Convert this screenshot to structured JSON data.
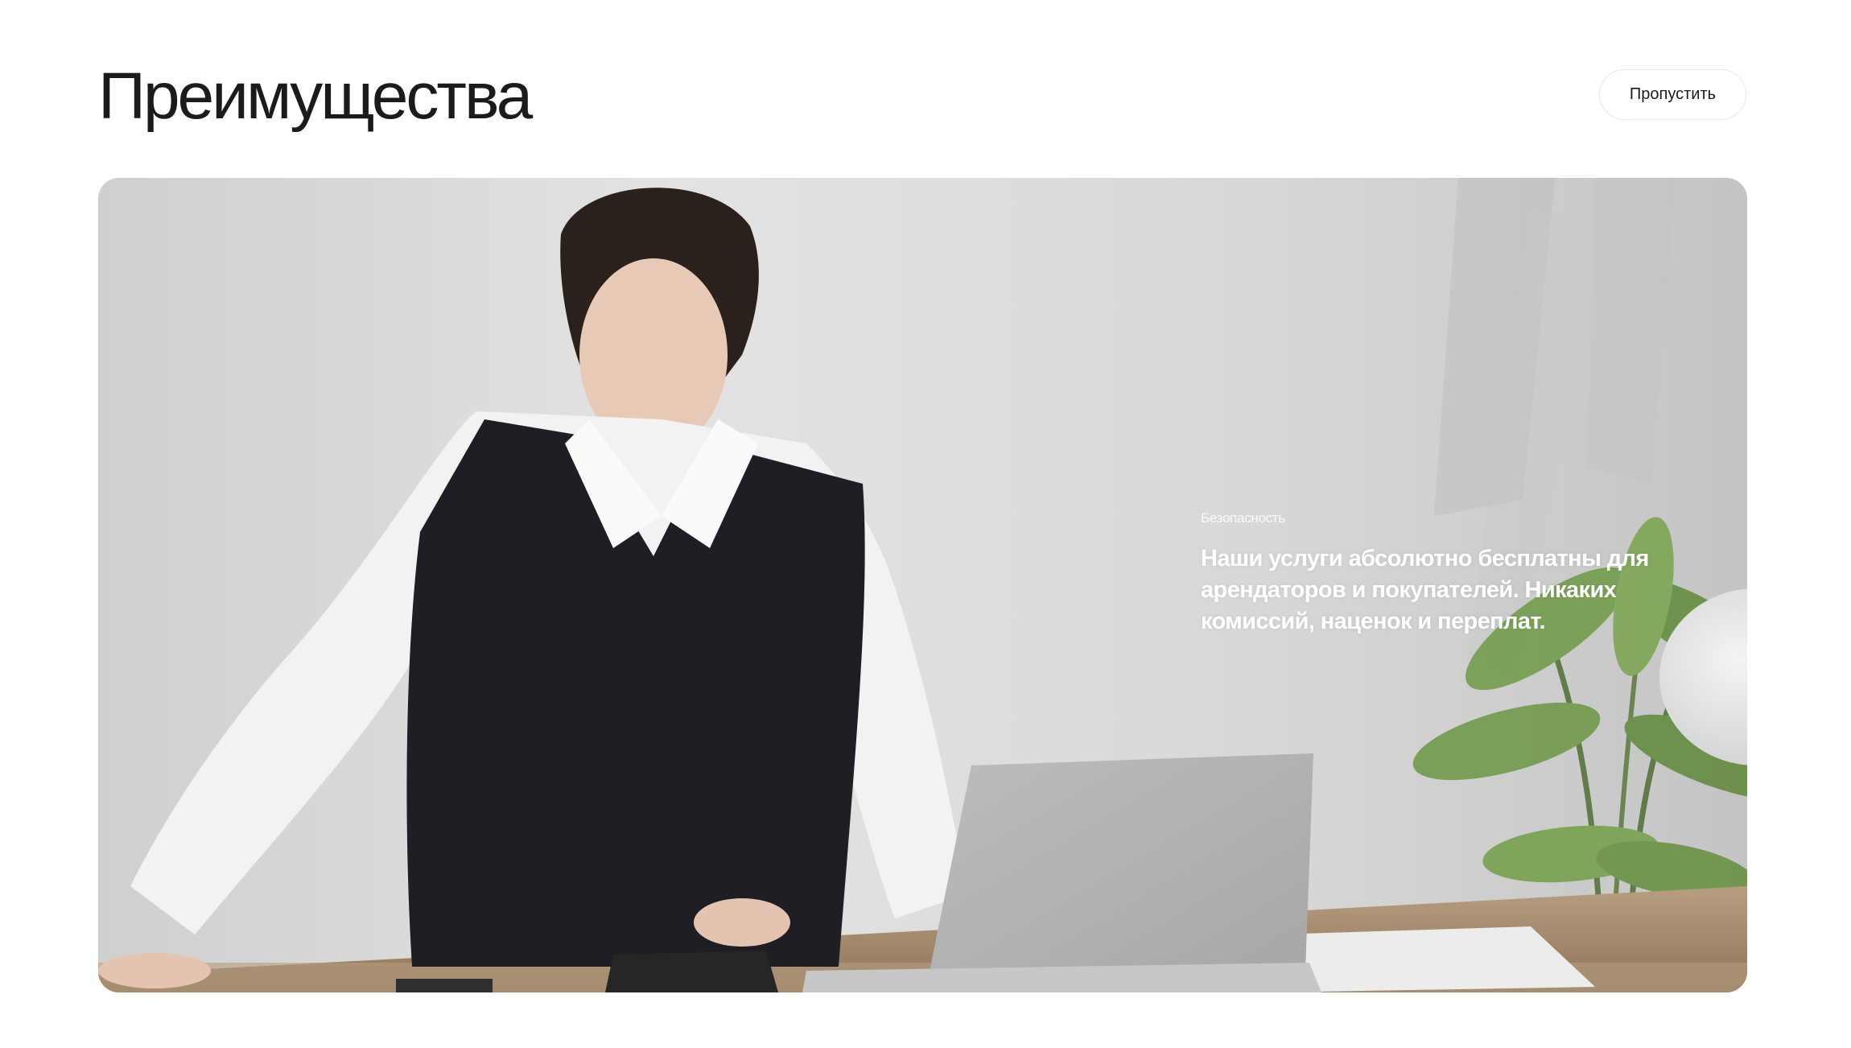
{
  "header": {
    "title": "Преимущества",
    "skip_label": "Пропустить"
  },
  "hero": {
    "eyebrow": "Безопасность",
    "heading": "Наши услуги абсолютно бесплатны для арендаторов и покупателей. Никаких комиссий, наценок и переплат."
  },
  "colors": {
    "background": "#ffffff",
    "title_text": "#1b1b1b",
    "hero_text": "#ffffff",
    "button_border": "#e7e7e7"
  }
}
